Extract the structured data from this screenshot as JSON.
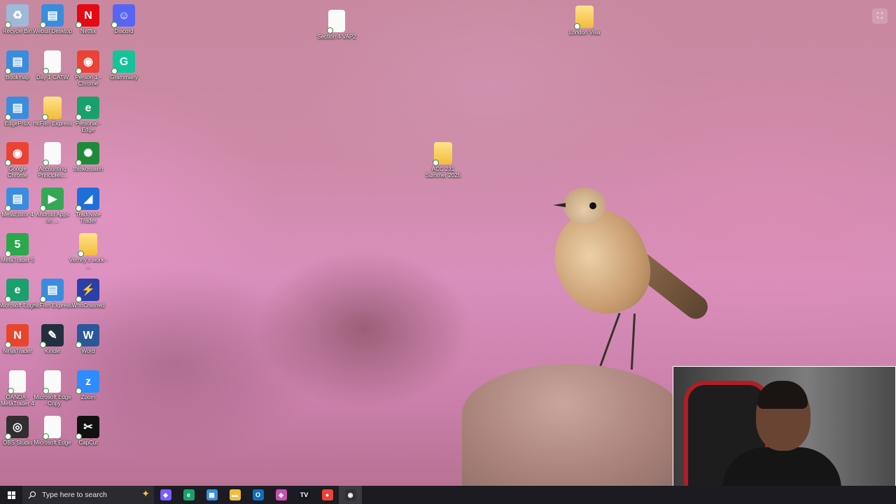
{
  "desktop_icons": [
    {
      "label": "Recycle Bin",
      "icon": "recycle-bin-icon",
      "color": "#9fb9d8"
    },
    {
      "label": "Webull Desktop",
      "icon": "webull-icon",
      "color": "#3a8dde"
    },
    {
      "label": "Netflix",
      "icon": "netflix-icon",
      "color": "#e50914"
    },
    {
      "label": "Discord",
      "icon": "discord-icon",
      "color": "#5865f2"
    },
    {
      "label": "Bookmap",
      "icon": "bookmap-icon",
      "color": "#3a8dde"
    },
    {
      "label": "Day 1 CATW",
      "icon": "document-icon",
      "color": "#f2bc3c"
    },
    {
      "label": "Person 1 - Chrome",
      "icon": "chrome-icon",
      "color": "#ea4335"
    },
    {
      "label": "Grammarly",
      "icon": "grammarly-icon",
      "color": "#15c39a"
    },
    {
      "label": "EdgeProX",
      "icon": "edgeprox-icon",
      "color": "#3a8dde"
    },
    {
      "label": "HitFilm Express",
      "icon": "folder-icon",
      "color": "#f2bc3c"
    },
    {
      "label": "Personal - Edge",
      "icon": "edge-icon",
      "color": "#1aa06d"
    },
    {
      "label": "Google Chrome",
      "icon": "chrome-icon",
      "color": "#ea4335"
    },
    {
      "label": "Accounting Principles...",
      "icon": "document-icon",
      "color": "#fafafa"
    },
    {
      "label": "thinkorswim",
      "icon": "thinkorswim-icon",
      "color": "#1f8a3a"
    },
    {
      "label": "MetaEditor 4",
      "icon": "metaeditor-icon",
      "color": "#3a8dde"
    },
    {
      "label": "Android Apps on ...",
      "icon": "play-store-icon",
      "color": "#34a853"
    },
    {
      "label": "Tradovate Trader",
      "icon": "tradovate-icon",
      "color": "#1e6fd9"
    },
    {
      "label": "MetaTrader 5",
      "icon": "metatrader-icon",
      "color": "#2aa84a"
    },
    {
      "label": "Vernny's work - ...",
      "icon": "folder-icon",
      "color": "#f2bc3c"
    },
    {
      "label": "Microsoft Edge",
      "icon": "edge-icon",
      "color": "#1aa06d"
    },
    {
      "label": "HitFilm Express",
      "icon": "hitfilm-icon",
      "color": "#3a8dde"
    },
    {
      "label": "WhoCrashed",
      "icon": "whocrashed-icon",
      "color": "#2a3fa8"
    },
    {
      "label": "NinjaTrader",
      "icon": "ninjatrader-icon",
      "color": "#e8452c"
    },
    {
      "label": "Kindle",
      "icon": "kindle-icon",
      "color": "#232f3e"
    },
    {
      "label": "Word",
      "icon": "word-icon",
      "color": "#2b579a"
    },
    {
      "label": "OANDA - MetaTrader 4",
      "icon": "document-icon",
      "color": "#fafafa"
    },
    {
      "label": "Microsoft Edge - Copy",
      "icon": "document-icon",
      "color": "#fafafa"
    },
    {
      "label": "Zoom",
      "icon": "zoom-icon",
      "color": "#2d8cff"
    },
    {
      "label": "OBS Studio",
      "icon": "obs-icon",
      "color": "#302e31"
    },
    {
      "label": "Microsoft Edge",
      "icon": "document-icon",
      "color": "#fafafa"
    },
    {
      "label": "CapCut",
      "icon": "capcut-icon",
      "color": "#111111"
    },
    {
      "label": "Section 4 VAP2",
      "icon": "document-icon",
      "color": "#fafafa"
    },
    {
      "label": "London Visa",
      "icon": "folder-icon",
      "color": "#f2bc3c"
    },
    {
      "label": "ACC 231 Summer 2025",
      "icon": "folder-icon",
      "color": "#f2bc3c"
    }
  ],
  "taskbar": {
    "search_placeholder": "Type here to search",
    "apps": [
      {
        "name": "copilot-icon",
        "glyph": "◈",
        "color": "#7b5cff"
      },
      {
        "name": "edge-icon",
        "glyph": "e",
        "color": "#1aa06d"
      },
      {
        "name": "store-icon",
        "glyph": "▦",
        "color": "#3a8dde"
      },
      {
        "name": "file-explorer-icon",
        "glyph": "▬",
        "color": "#f2bc3c"
      },
      {
        "name": "outlook-icon",
        "glyph": "O",
        "color": "#0f6cbd"
      },
      {
        "name": "microsoft-365-icon",
        "glyph": "◆",
        "color": "#c84fb0"
      },
      {
        "name": "tradingview-icon",
        "glyph": "TV",
        "color": "#131722"
      },
      {
        "name": "chrome-icon",
        "glyph": "●",
        "color": "#ea4335"
      },
      {
        "name": "obs-icon",
        "glyph": "◉",
        "color": "#302e31"
      }
    ]
  }
}
